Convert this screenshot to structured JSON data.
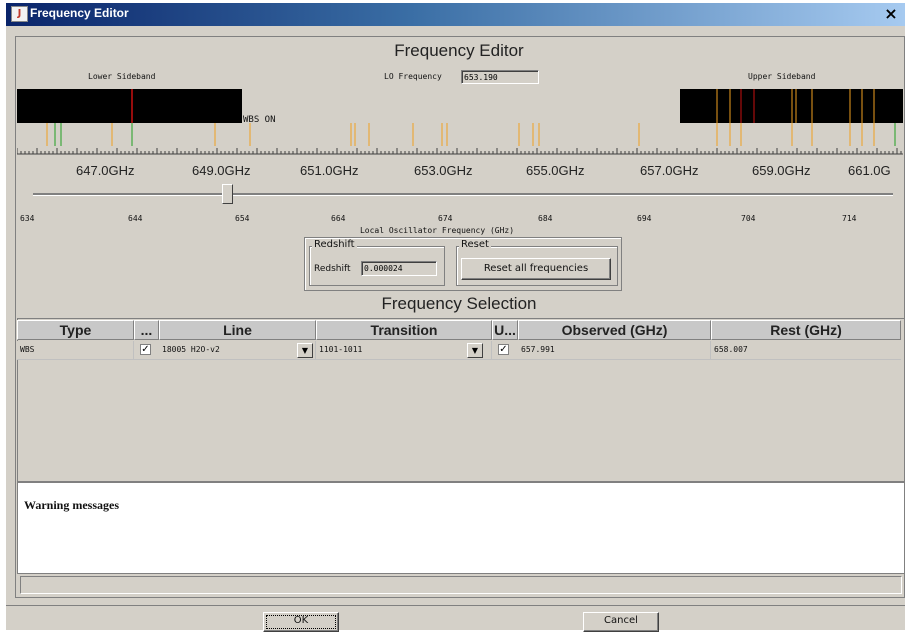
{
  "window": {
    "title": "Frequency Editor",
    "close_glyph": "×",
    "icon": "java-icon"
  },
  "editor": {
    "heading": "Frequency Editor",
    "lower_sideband_label": "Lower Sideband",
    "upper_sideband_label": "Upper Sideband",
    "lo_frequency_label": "LO Frequency",
    "lo_frequency_value": "653.190",
    "wbs_on_label": "WBS ON",
    "freq_ticks": [
      "647.0GHz",
      "649.0GHz",
      "651.0GHz",
      "653.0GHz",
      "655.0GHz",
      "657.0GHz",
      "659.0GHz",
      "661.0G"
    ],
    "lo_slider": {
      "ticks": [
        "634",
        "644",
        "654",
        "664",
        "674",
        "684",
        "694",
        "704",
        "714"
      ],
      "axis_label": "Local Oscillator Frequency (GHz)"
    }
  },
  "redshift": {
    "group_label": "Redshift",
    "field_label": "Redshift",
    "value": "0.000024"
  },
  "reset": {
    "group_label": "Reset",
    "button_label": "Reset all frequencies"
  },
  "selection": {
    "heading": "Frequency Selection",
    "columns": [
      "Type",
      "...",
      "Line",
      "Transition",
      "U...",
      "Observed (GHz)",
      "Rest (GHz)"
    ],
    "rows": [
      {
        "type": "WBS",
        "checked": "✓",
        "line": "18005  H2O-v2",
        "transition": "1101-1011",
        "used": "✓",
        "observed": "657.991",
        "rest": "658.007"
      }
    ]
  },
  "warnings": {
    "title": "Warning messages"
  },
  "footer": {
    "ok_label": "OK",
    "cancel_label": "Cancel"
  },
  "colors": {
    "line_orange": "#f0a020",
    "line_red": "#c81010",
    "line_green": "#20a020",
    "band_black": "#000000"
  }
}
